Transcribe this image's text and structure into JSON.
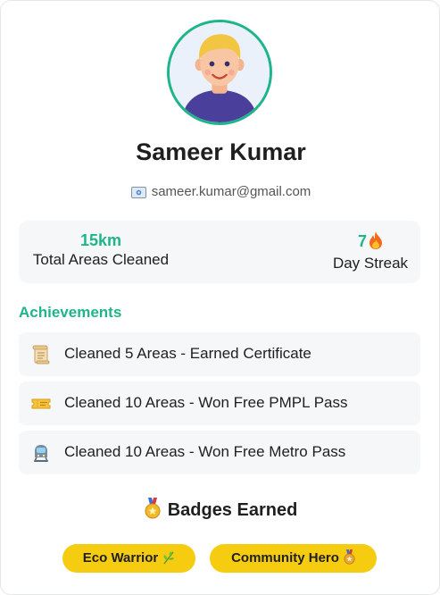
{
  "profile": {
    "name": "Sameer Kumar",
    "email": "sameer.kumar@gmail.com",
    "email_icon": "envelope-icon"
  },
  "stats": {
    "areas_value": "15km",
    "areas_label": "Total Areas Cleaned",
    "streak_value": "7",
    "streak_icon": "fire-icon",
    "streak_label": "Day Streak"
  },
  "achievements": {
    "title": "Achievements",
    "items": [
      {
        "icon": "scroll-icon",
        "label": "Cleaned 5 Areas - Earned Certificate"
      },
      {
        "icon": "ticket-icon",
        "label": "Cleaned 10 Areas - Won Free PMPL Pass"
      },
      {
        "icon": "metro-icon",
        "label": "Cleaned 10 Areas - Won Free Metro Pass"
      }
    ]
  },
  "badges": {
    "title": "Badges Earned",
    "title_icon": "medal-icon",
    "items": [
      {
        "label": "Eco Warrior",
        "icon": "herb-icon"
      },
      {
        "label": "Community Hero",
        "icon": "medal-icon"
      }
    ]
  },
  "colors": {
    "accent": "#1fb58a",
    "badge": "#f5cc10",
    "panel": "#f6f7f9"
  }
}
